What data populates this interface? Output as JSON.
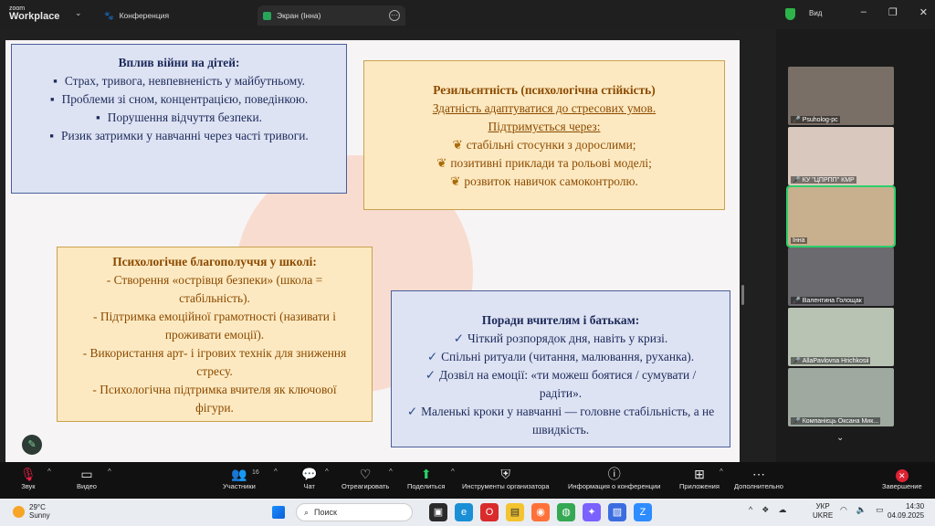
{
  "titlebar": {
    "brand_top": "zoom",
    "brand_bottom": "Workplace",
    "tab_conference": "Конференция",
    "tab_share": "Экран (Інна)",
    "view_label": "Вид",
    "accent": "#2db34a"
  },
  "slide": {
    "box1": {
      "title": "Вплив війни на дітей:",
      "items": [
        "Страх, тривога, невпевненість у майбутньому.",
        "Проблеми зі сном, концентрацією, поведінкою.",
        "Порушення відчуття безпеки.",
        "Ризик затримки у навчанні через часті тривоги."
      ]
    },
    "box2": {
      "title": "Резильєнтність (психологічна стійкість)",
      "line1": "Здатність адаптуватися до стресових умов.",
      "line2": "Підтримується через:",
      "items": [
        "стабільні стосунки з дорослими;",
        "позитивні приклади та рольові моделі;",
        "розвиток навичок самоконтролю."
      ]
    },
    "box3": {
      "title": "Психологічне благополуччя у школі:",
      "items": [
        "- Створення «острівця безпеки» (школа = стабільність).",
        "-    Підтримка емоційної грамотності (називати і проживати емоції).",
        "-    Використання арт- і ігрових технік для зниження стресу.",
        "-    Психологічна підтримка вчителя як ключової фігури."
      ]
    },
    "box4": {
      "title": "Поради вчителям і батькам:",
      "items": [
        "Чіткий розпорядок дня, навіть у кризі.",
        "Спільні ритуали (читання, малювання, руханка).",
        "Дозвіл на емоції: «ти можеш боятися / сумувати / радіти».",
        "Маленькі кроки у навчанні — головне стабільність, а не швидкість."
      ]
    }
  },
  "participants": [
    {
      "name": "Psuholog-pc",
      "muted": true
    },
    {
      "name": "КУ \"ЦПРПП\" КМР",
      "muted": true
    },
    {
      "name": "Інна",
      "muted": false,
      "active": true
    },
    {
      "name": "Валентина Голощак",
      "muted": true
    },
    {
      "name": "AllaPavlovna Hrichkosii",
      "muted": true
    },
    {
      "name": "Компанієць Оксана Мик...",
      "muted": true
    }
  ],
  "toolbar": {
    "audio": "Звук",
    "video": "Видео",
    "participants": "Участники",
    "participants_count": "16",
    "chat": "Чат",
    "react": "Отреагировать",
    "share": "Поделиться",
    "host_tools": "Инструменты организатора",
    "info": "Информация о конференции",
    "apps": "Приложения",
    "more": "Дополнительно",
    "end": "Завершение"
  },
  "taskbar": {
    "temp": "29°C",
    "weather": "Sunny",
    "search_placeholder": "Поиск",
    "lang_top": "УКР",
    "lang_bottom": "UKRE",
    "time": "14:30",
    "date": "04.09.2025"
  }
}
